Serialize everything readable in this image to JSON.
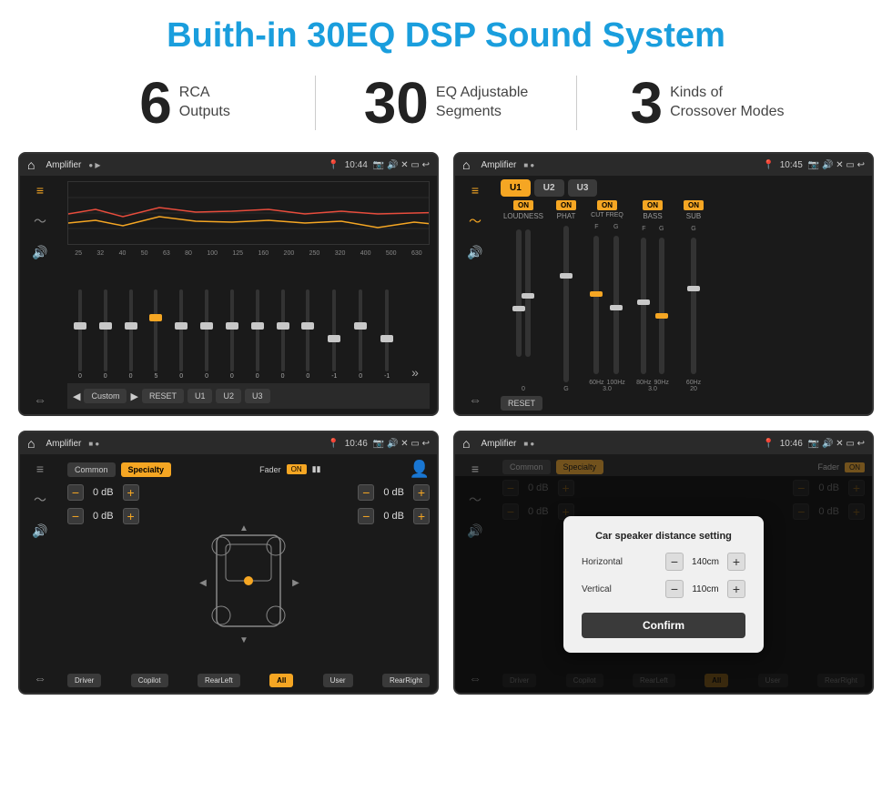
{
  "header": {
    "title": "Buith-in 30EQ DSP Sound System"
  },
  "stats": [
    {
      "number": "6",
      "line1": "RCA",
      "line2": "Outputs"
    },
    {
      "number": "30",
      "line1": "EQ Adjustable",
      "line2": "Segments"
    },
    {
      "number": "3",
      "line1": "Kinds of",
      "line2": "Crossover Modes"
    }
  ],
  "screens": {
    "eq": {
      "topbar_title": "Amplifier",
      "time": "10:44",
      "freq_labels": [
        "25",
        "32",
        "40",
        "50",
        "63",
        "80",
        "100",
        "125",
        "160",
        "200",
        "250",
        "320",
        "400",
        "500",
        "630"
      ],
      "values": [
        "0",
        "0",
        "0",
        "5",
        "0",
        "0",
        "0",
        "0",
        "0",
        "0",
        "-1",
        "0",
        "-1"
      ],
      "preset": "Custom",
      "buttons": [
        "RESET",
        "U1",
        "U2",
        "U3"
      ]
    },
    "crossover": {
      "topbar_title": "Amplifier",
      "time": "10:45",
      "units": [
        "U1",
        "U2",
        "U3"
      ],
      "controls": [
        "LOUDNESS",
        "PHAT",
        "CUT FREQ",
        "BASS",
        "SUB"
      ],
      "reset": "RESET"
    },
    "fader": {
      "topbar_title": "Amplifier",
      "time": "10:46",
      "tabs": [
        "Common",
        "Specialty"
      ],
      "fader_label": "Fader",
      "on_label": "ON",
      "levels": [
        "0 dB",
        "0 dB",
        "0 dB",
        "0 dB"
      ],
      "bottom_buttons": [
        "Driver",
        "Copilot",
        "RearLeft",
        "All",
        "User",
        "RearRight"
      ]
    },
    "dialog": {
      "topbar_title": "Amplifier",
      "time": "10:46",
      "tabs": [
        "Common",
        "Specialty"
      ],
      "dialog_title": "Car speaker distance setting",
      "horizontal_label": "Horizontal",
      "horizontal_value": "140cm",
      "vertical_label": "Vertical",
      "vertical_value": "110cm",
      "confirm_label": "Confirm",
      "levels": [
        "0 dB",
        "0 dB"
      ],
      "bottom_buttons": [
        "Driver",
        "Copilot",
        "RearLeft",
        "All",
        "User",
        "RearRight"
      ]
    }
  }
}
